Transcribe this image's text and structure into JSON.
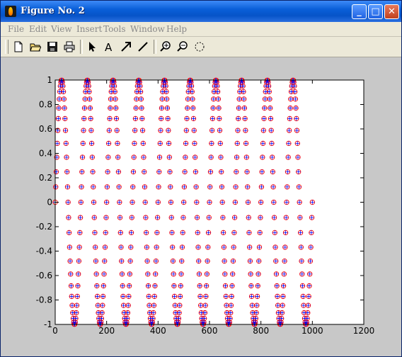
{
  "window": {
    "title": "Figure No. 2",
    "buttons": {
      "minimize": "_",
      "maximize": "□",
      "close": "✕"
    }
  },
  "menu": {
    "items": [
      "File",
      "Edit",
      "View",
      "Insert",
      "Tools",
      "Window",
      "Help"
    ]
  },
  "toolbar": {
    "tools": [
      "new-file-icon",
      "open-file-icon",
      "save-icon",
      "print-icon",
      "select-arrow-icon",
      "insert-text-icon",
      "insert-arrow-icon",
      "insert-line-icon",
      "zoom-in-icon",
      "zoom-out-icon",
      "rotate-3d-icon"
    ]
  },
  "colors": {
    "titlebar": "#0a5fd8",
    "plot_bg": "#ffffff",
    "figure_bg": "#c8c8c8",
    "series_circle": "#ff0000",
    "series_plus": "#0000ff"
  },
  "chart_data": {
    "type": "scatter",
    "title": "",
    "xlabel": "",
    "ylabel": "",
    "xlim": [
      0,
      1200
    ],
    "ylim": [
      -1,
      1
    ],
    "xticks": [
      "0",
      "200",
      "400",
      "600",
      "800",
      "1000",
      "1200"
    ],
    "yticks": [
      "-1",
      "-0.8",
      "-0.6",
      "-0.4",
      "-0.2",
      "0",
      "0.2",
      "0.4",
      "0.6",
      "0.8",
      "1"
    ],
    "grid": false,
    "legend": false,
    "series": [
      {
        "marker": "circle",
        "color": "#ff0000",
        "function": "sin(2*pi*x/100)",
        "x_start": 0,
        "x_end": 1000,
        "x_step": 2
      },
      {
        "marker": "plus",
        "color": "#0000ff",
        "function": "sin(2*pi*x/100)",
        "x_start": 0,
        "x_end": 1000,
        "x_step": 2
      }
    ]
  }
}
